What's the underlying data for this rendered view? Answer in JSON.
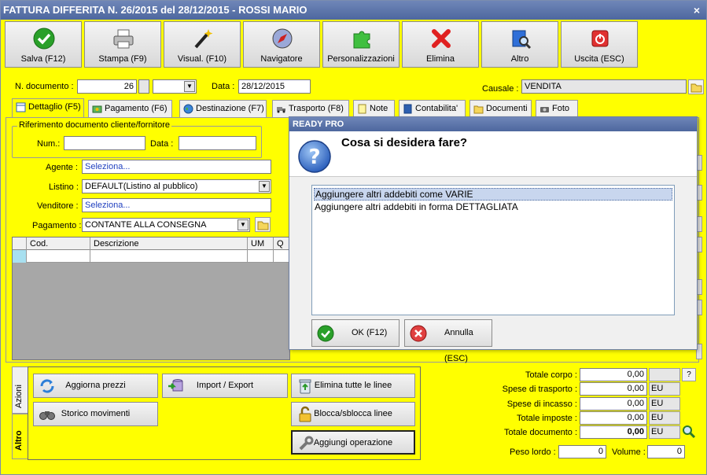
{
  "window": {
    "title": "FATTURA DIFFERITA N. 26/2015 del 28/12/2015 - ROSSI MARIO",
    "close": "×"
  },
  "toolbar": [
    {
      "label": "Salva (F12)",
      "icon": "check-icon"
    },
    {
      "label": "Stampa (F9)",
      "icon": "printer-icon"
    },
    {
      "label": "Visual. (F10)",
      "icon": "magic-wand-icon"
    },
    {
      "label": "Navigatore",
      "icon": "compass-icon"
    },
    {
      "label": "Personalizzazioni",
      "icon": "puzzle-icon"
    },
    {
      "label": "Elimina",
      "icon": "delete-x-icon"
    },
    {
      "label": "Altro",
      "icon": "book-search-icon"
    },
    {
      "label": "Uscita (ESC)",
      "icon": "power-icon"
    }
  ],
  "header": {
    "doc_label": "N. documento :",
    "doc_number": "26",
    "doc_series": "",
    "data_label": "Data :",
    "data_value": "28/12/2015",
    "causale_label": "Causale :",
    "causale_value": "VENDITA"
  },
  "tabs": [
    {
      "label": "Dettaglio (F5)"
    },
    {
      "label": "Pagamento (F6)"
    },
    {
      "label": "Destinazione (F7)"
    },
    {
      "label": "Trasporto (F8)"
    },
    {
      "label": "Note"
    },
    {
      "label": "Contabilita'"
    },
    {
      "label": "Documenti"
    },
    {
      "label": "Foto"
    }
  ],
  "riferimento": {
    "title": "Riferimento documento cliente/fornitore",
    "num_label": "Num.:",
    "num_value": "",
    "data_label": "Data :",
    "data_value": ""
  },
  "form": {
    "agente_label": "Agente :",
    "agente_value": "Seleziona...",
    "listino_label": "Listino :",
    "listino_value": "DEFAULT(Listino al pubblico)",
    "venditore_label": "Venditore :",
    "venditore_value": "Seleziona...",
    "pagamento_label": "Pagamento :",
    "pagamento_value": "CONTANTE ALLA CONSEGNA"
  },
  "grid": {
    "columns": [
      "Cod.",
      "Descrizione",
      "UM",
      "Q"
    ]
  },
  "side_tabs": [
    "Azioni",
    "Altro"
  ],
  "actions": [
    {
      "label": "Aggiorna prezzi",
      "icon": "refresh-icon"
    },
    {
      "label": "Import / Export",
      "icon": "database-import-icon"
    },
    {
      "label": "Elimina tutte le linee",
      "icon": "recycle-bin-icon"
    },
    {
      "label": "Storico movimenti",
      "icon": "binoculars-icon"
    },
    {
      "label": "Blocca/sblocca linee",
      "icon": "padlock-icon"
    },
    {
      "label": "Aggiungi operazione",
      "icon": "wrench-icon"
    }
  ],
  "totals": {
    "totale_corpo_label": "Totale corpo :",
    "totale_corpo": "0,00",
    "help": "?",
    "spese_trasporto_label": "Spese di trasporto :",
    "spese_trasporto": "0,00",
    "spese_incasso_label": "Spese di incasso :",
    "spese_incasso": "0,00",
    "totale_imposte_label": "Totale imposte :",
    "totale_imposte": "0,00",
    "totale_documento_label": "Totale documento :",
    "totale_documento": "0,00",
    "currency": "EU",
    "peso_label": "Peso lordo :",
    "peso_value": "0",
    "volume_label": "Volume :",
    "volume_value": "0"
  },
  "dialog": {
    "title": "READY PRO",
    "question": "Cosa si desidera fare?",
    "options": [
      "Aggiungere altri addebiti come VARIE",
      "Aggiungere altri addebiti in forma DETTAGLIATA"
    ],
    "ok_label": "OK (F12)",
    "cancel_label": "Annulla (ESC)"
  },
  "colors": {
    "background": "#ffff00",
    "titlebar": "#5b73a8",
    "selection": "#c8d6ee"
  }
}
